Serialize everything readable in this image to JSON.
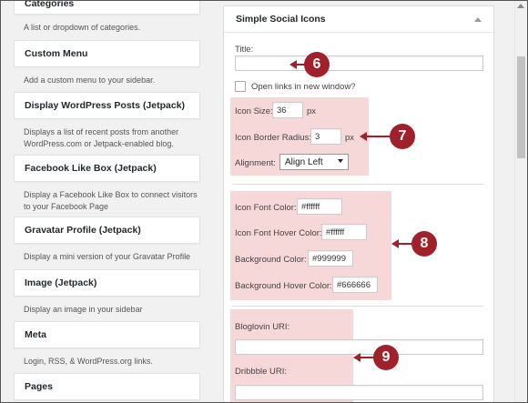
{
  "widgets": [
    {
      "title": "Categories",
      "desc": "A list or dropdown of categories."
    },
    {
      "title": "Custom Menu",
      "desc": "Add a custom menu to your sidebar."
    },
    {
      "title": "Display WordPress Posts (Jetpack)",
      "desc": "Displays a list of recent posts from another WordPress.com or Jetpack-enabled blog."
    },
    {
      "title": "Facebook Like Box (Jetpack)",
      "desc": "Display a Facebook Like Box to connect visitors to your Facebook Page"
    },
    {
      "title": "Gravatar Profile (Jetpack)",
      "desc": "Display a mini version of your Gravatar Profile"
    },
    {
      "title": "Image (Jetpack)",
      "desc": "Display an image in your sidebar"
    },
    {
      "title": "Meta",
      "desc": "Login, RSS, & WordPress.org links."
    },
    {
      "title": "Pages",
      "desc": ""
    }
  ],
  "panel": {
    "title": "Simple Social Icons",
    "title_label": "Title:",
    "title_value": "",
    "new_window_label": "Open links in new window?",
    "new_window_checked": false,
    "icon_size_label": "Icon Size:",
    "icon_size_value": "36",
    "icon_size_unit": "px",
    "border_radius_label": "Icon Border Radius:",
    "border_radius_value": "3",
    "border_radius_unit": "px",
    "alignment_label": "Alignment:",
    "alignment_value": "Align Left",
    "font_color_label": "Icon Font Color:",
    "font_color_value": "#ffffff",
    "font_hover_label": "Icon Font Hover Color:",
    "font_hover_value": "#ffffff",
    "bg_color_label": "Background Color:",
    "bg_color_value": "#999999",
    "bg_hover_label": "Background Hover Color:",
    "bg_hover_value": "#666666",
    "bloglovin_label": "Bloglovin URI:",
    "bloglovin_value": "",
    "dribbble_label": "Dribbble URI:",
    "dribbble_value": ""
  },
  "callouts": [
    "6",
    "7",
    "8",
    "9"
  ],
  "colors": {
    "callout": "#a0202b",
    "highlight": "#f3cbcb"
  }
}
